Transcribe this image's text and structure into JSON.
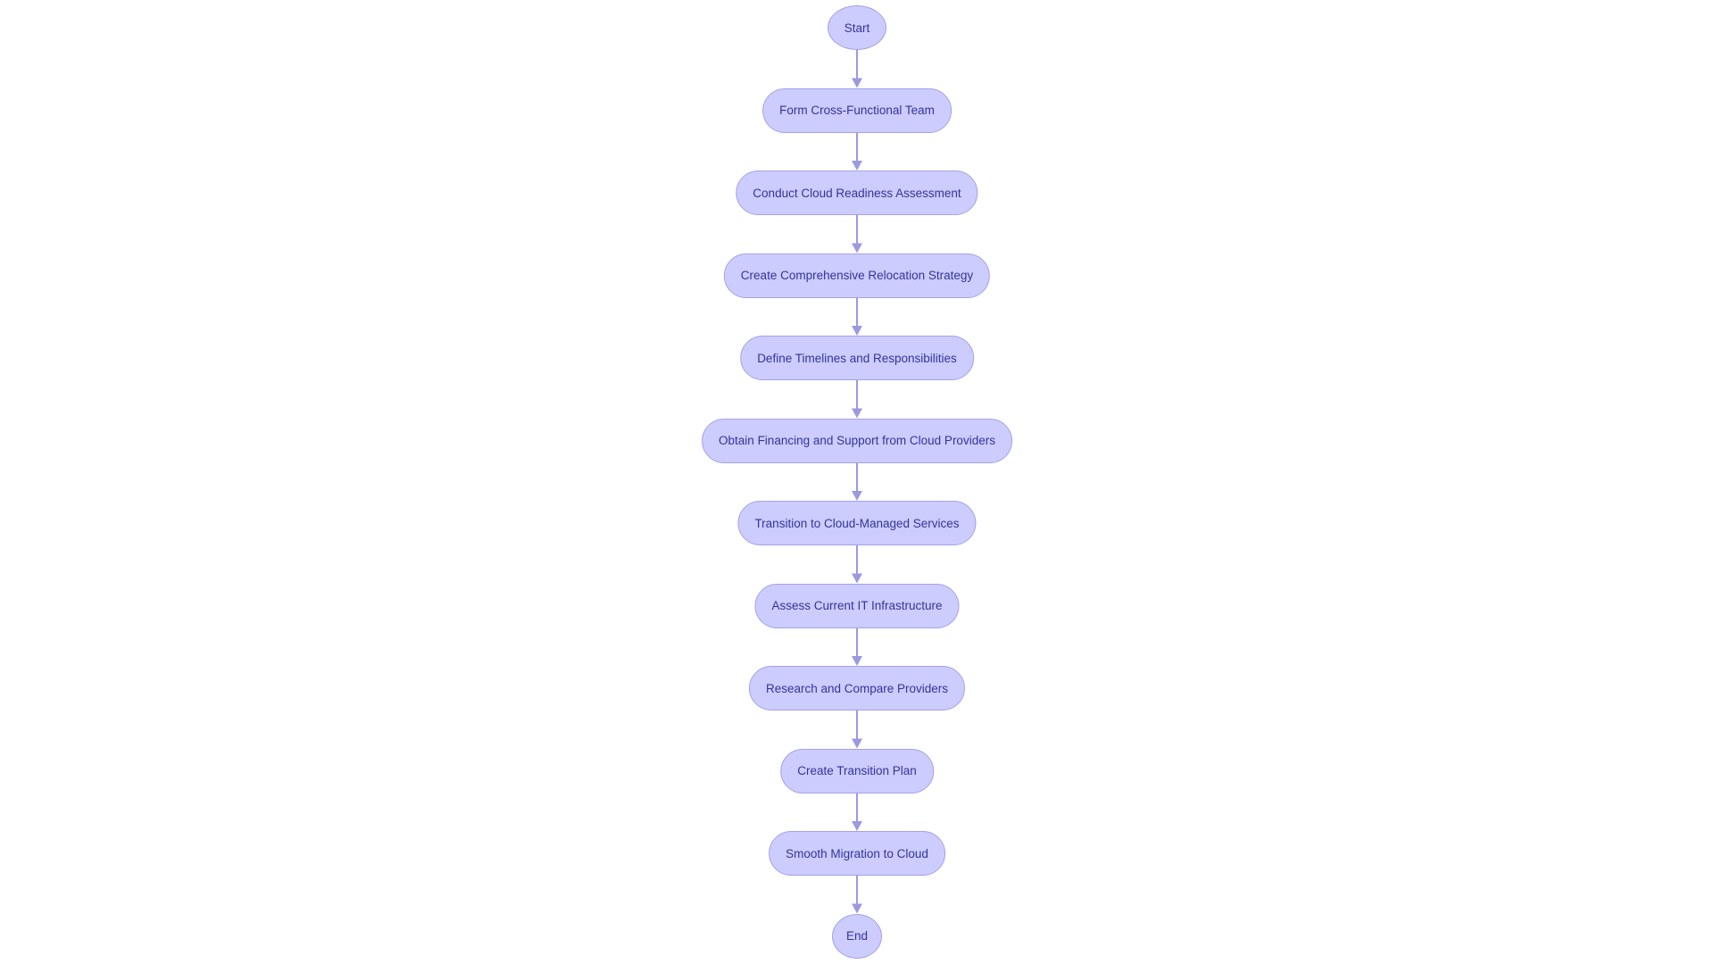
{
  "diagram": {
    "type": "flowchart",
    "direction": "top-to-bottom",
    "colors": {
      "node_fill": "#ccccff",
      "node_border": "#a3a3e6",
      "node_text": "#333399",
      "edge": "#9a9ae0",
      "background": "#ffffff"
    },
    "nodes": [
      {
        "id": "start",
        "label": "Start",
        "shape": "circle"
      },
      {
        "id": "team",
        "label": "Form Cross-Functional Team",
        "shape": "stadium"
      },
      {
        "id": "assess_ready",
        "label": "Conduct Cloud Readiness Assessment",
        "shape": "stadium"
      },
      {
        "id": "strategy",
        "label": "Create Comprehensive Relocation Strategy",
        "shape": "stadium"
      },
      {
        "id": "timelines",
        "label": "Define Timelines and Responsibilities",
        "shape": "stadium"
      },
      {
        "id": "financing",
        "label": "Obtain Financing and Support from Cloud Providers",
        "shape": "stadium"
      },
      {
        "id": "transition",
        "label": "Transition to Cloud-Managed Services",
        "shape": "stadium"
      },
      {
        "id": "assess_it",
        "label": "Assess Current IT Infrastructure",
        "shape": "stadium"
      },
      {
        "id": "research",
        "label": "Research and Compare Providers",
        "shape": "stadium"
      },
      {
        "id": "plan",
        "label": "Create Transition Plan",
        "shape": "stadium"
      },
      {
        "id": "migration",
        "label": "Smooth Migration to Cloud",
        "shape": "stadium"
      },
      {
        "id": "end",
        "label": "End",
        "shape": "circle"
      }
    ],
    "edges": [
      {
        "from": "start",
        "to": "team"
      },
      {
        "from": "team",
        "to": "assess_ready"
      },
      {
        "from": "assess_ready",
        "to": "strategy"
      },
      {
        "from": "strategy",
        "to": "timelines"
      },
      {
        "from": "timelines",
        "to": "financing"
      },
      {
        "from": "financing",
        "to": "transition"
      },
      {
        "from": "transition",
        "to": "assess_it"
      },
      {
        "from": "assess_it",
        "to": "research"
      },
      {
        "from": "research",
        "to": "plan"
      },
      {
        "from": "plan",
        "to": "migration"
      },
      {
        "from": "migration",
        "to": "end"
      }
    ]
  }
}
